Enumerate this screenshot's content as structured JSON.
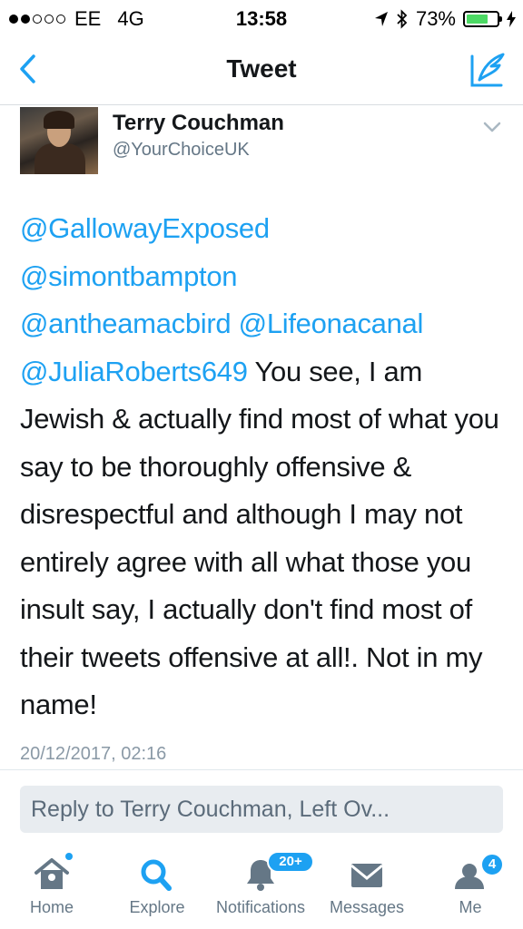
{
  "status_bar": {
    "carrier": "EE",
    "network": "4G",
    "time": "13:58",
    "battery": "73%",
    "battery_level": 0.73
  },
  "nav": {
    "title": "Tweet"
  },
  "tweet": {
    "author_name": "Terry Couchman",
    "author_handle": "@YourChoiceUK",
    "mentions": [
      "@GallowayExposed",
      "@simontbampton",
      "@antheamacbird",
      "@Lifeonacanal",
      "@JuliaRoberts649"
    ],
    "text": "You see, I am Jewish & actually find most of what you say to be thoroughly offensive & disrespectful and although I may not entirely agree with all what those you insult say, I actually don't find most of their tweets offensive at all!. Not in my name!",
    "timestamp": "20/12/2017, 02:16"
  },
  "reply": {
    "placeholder": "Reply to Terry Couchman, Left Ov..."
  },
  "tabs": [
    {
      "label": "Home",
      "icon": "home-icon",
      "active": false
    },
    {
      "label": "Explore",
      "icon": "search-icon",
      "active": true
    },
    {
      "label": "Notifications",
      "icon": "bell-icon",
      "badge": "20+",
      "active": false
    },
    {
      "label": "Messages",
      "icon": "envelope-icon",
      "active": false
    },
    {
      "label": "Me",
      "icon": "person-icon",
      "badge": "4",
      "active": false
    }
  ],
  "colors": {
    "accent": "#1da1f2",
    "text": "#14171a",
    "muted": "#657786",
    "battery": "#4cd964"
  }
}
